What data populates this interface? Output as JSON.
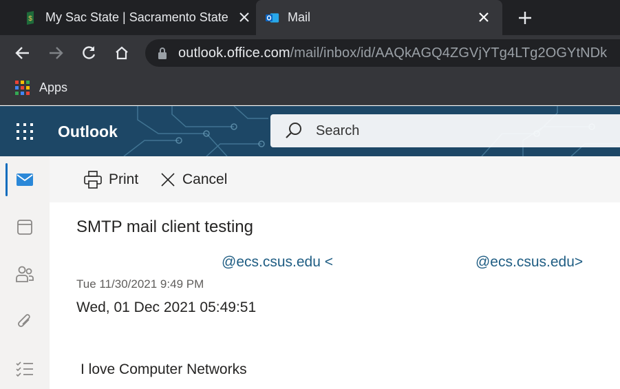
{
  "browser": {
    "tabs": [
      {
        "title": "My Sac State | Sacramento State",
        "active": false,
        "favicon": "sac-state-icon"
      },
      {
        "title": "Mail",
        "active": true,
        "favicon": "outlook-icon"
      }
    ],
    "url": {
      "host": "outlook.office.com",
      "path": "/mail/inbox/id/AAQkAGQ4ZGVjYTg4LTg2OGYtNDk"
    },
    "bookmarks": {
      "apps_label": "Apps"
    },
    "colors": {
      "frame": "#202124",
      "toolbar": "#35363a",
      "text": "#e8eaed"
    }
  },
  "owa": {
    "brand": "Outlook",
    "search": {
      "placeholder": "Search"
    },
    "rail": [
      "mail-icon",
      "calendar-icon",
      "people-icon",
      "attachment-icon",
      "todo-icon"
    ],
    "commands": {
      "print": "Print",
      "cancel": "Cancel"
    },
    "colors": {
      "header": "#1e4e6e",
      "link": "#1f5d83",
      "accent": "#0f6cbd"
    }
  },
  "message": {
    "subject": "SMTP mail client testing",
    "from_address": "@ecs.csus.edu <",
    "to_address": "@ecs.csus.edu>",
    "sent": "Tue 11/30/2021 9:49 PM",
    "date_line": "Wed, 01 Dec 2021 05:49:51",
    "body": "I love Computer Networks"
  }
}
